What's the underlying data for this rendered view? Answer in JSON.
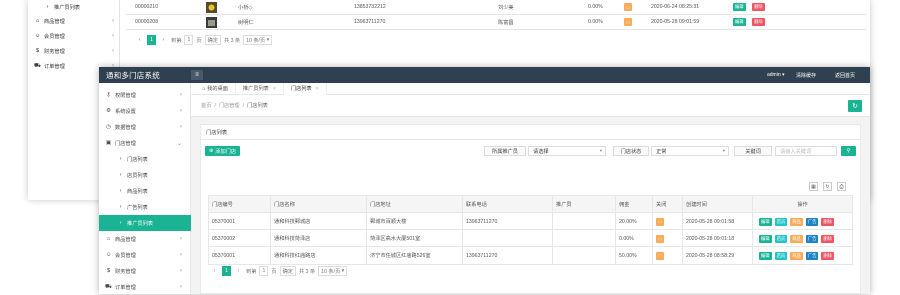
{
  "bg_window": {
    "sidebar": [
      {
        "label": "推广员列表",
        "icon": "chevron-right-icon",
        "sub": true
      },
      {
        "label": "商品管理",
        "icon": "home-icon"
      },
      {
        "label": "会员管理",
        "icon": "users-icon"
      },
      {
        "label": "财务管理",
        "icon": "dollar-icon"
      },
      {
        "label": "订单管理",
        "icon": "cart-icon"
      }
    ],
    "rows": [
      {
        "id": "00000210",
        "name": "小桥◇",
        "phone": "13853732212",
        "agent": "刘少美",
        "rate": "0.00%",
        "time": "2020-06-24 08:25:31",
        "edit": "编辑",
        "del": "删除"
      },
      {
        "id": "00000208",
        "name": "树明仁",
        "phone": "13963711270",
        "agent": "陈富昌",
        "rate": "0.00%",
        "time": "2020-05-28 09:01:59",
        "edit": "编辑",
        "del": "删除"
      }
    ],
    "pager": {
      "prev": "‹",
      "page": "1",
      "next": "›",
      "goto_label": "到第",
      "goto_value": "1",
      "page_unit": "页",
      "confirm": "确定",
      "total": "共 3 条",
      "page_size": "10 条/页"
    }
  },
  "app": {
    "brand": "通和多门店系统",
    "menu_icon": "≡",
    "user": "admin",
    "clear_cache": "清除缓存",
    "home": "返回首页"
  },
  "sidebar": {
    "items": [
      {
        "label": "权限管理",
        "icon": "key-icon"
      },
      {
        "label": "系统设置",
        "icon": "gear-icon"
      },
      {
        "label": "数据管理",
        "icon": "clock-icon"
      },
      {
        "label": "门店管理",
        "icon": "store-icon"
      }
    ],
    "subitems": [
      "门店列表",
      "店员列表",
      "商品列表",
      "广告列表",
      "推广员列表"
    ],
    "after": [
      {
        "label": "商品管理",
        "icon": "home-icon"
      },
      {
        "label": "会员管理",
        "icon": "users-icon"
      },
      {
        "label": "财务管理",
        "icon": "dollar-icon"
      },
      {
        "label": "订单管理",
        "icon": "cart-icon"
      }
    ]
  },
  "tabs": [
    {
      "label": "我的桌面",
      "icon": "home-icon"
    },
    {
      "label": "推广员列表"
    },
    {
      "label": "门店列表"
    }
  ],
  "breadcrumb": [
    "首页",
    "门店管理",
    "门店列表"
  ],
  "panel": {
    "title": "门店列表",
    "add_button": "添加门店",
    "filters": {
      "promoter_label": "所属推广员",
      "promoter_value": "请选择",
      "status_label": "门店状态",
      "status_value": "正常",
      "keyword_label": "关键词",
      "keyword_placeholder": "请输入关键词"
    }
  },
  "table": {
    "columns": [
      "门店编号",
      "门店名称",
      "门店地址",
      "联系电话",
      "推广员",
      "佣金",
      "关闭",
      "创建时间",
      "操作"
    ],
    "rows": [
      {
        "id": "05370001",
        "name": "通和科技鄄城店",
        "addr": "鄄城市百顺大楼",
        "phone": "13963711270",
        "promoter": "",
        "rate": "20.00%",
        "time": "2020-05-28 09:01:58"
      },
      {
        "id": "05370002",
        "name": "通和科技菏泽店",
        "addr": "菏泽区高水大厦501室",
        "phone": "",
        "promoter": "",
        "rate": "0.00%",
        "time": "2020-05-28 09:01:18"
      },
      {
        "id": "05370001",
        "name": "通和科技红庙路店",
        "addr": "济宁市任城区红庙路526室",
        "phone": "13963711270",
        "promoter": "",
        "rate": "50.00%",
        "time": "2020-05-28 08:58:29"
      }
    ],
    "ops": [
      "编辑",
      "店员",
      "商品",
      "广告",
      "删除"
    ]
  },
  "pager": {
    "prev": "‹",
    "page": "1",
    "next": "›",
    "goto_label": "到第",
    "goto_value": "1",
    "page_unit": "页",
    "confirm": "确定",
    "total": "共 3 条",
    "page_size": "10 条/页"
  },
  "colors": {
    "accent": "#1ab394",
    "topbar": "#2f4050",
    "danger": "#ed5565",
    "warning": "#f8ac59",
    "info": "#23c6c8",
    "primary": "#1c84c6"
  }
}
